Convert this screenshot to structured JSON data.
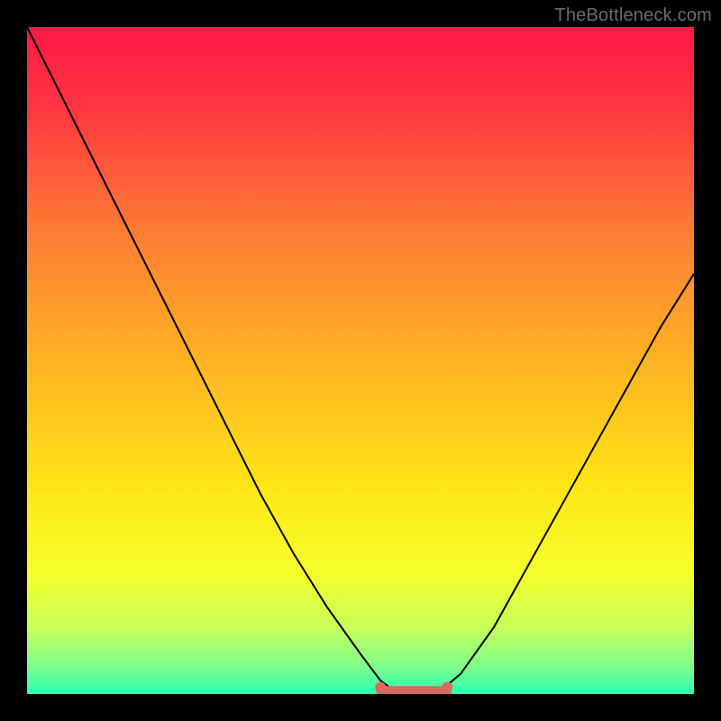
{
  "watermark": "TheBottleneck.com",
  "colors": {
    "frame": "#000000",
    "curve": "#000000",
    "marker": "#d9695f",
    "gradient_stops": [
      {
        "offset": 0.0,
        "color": "#ff1846"
      },
      {
        "offset": 0.12,
        "color": "#ff3642"
      },
      {
        "offset": 0.3,
        "color": "#ff7a34"
      },
      {
        "offset": 0.5,
        "color": "#ffb224"
      },
      {
        "offset": 0.68,
        "color": "#ffe317"
      },
      {
        "offset": 0.82,
        "color": "#f4ff2a"
      },
      {
        "offset": 0.9,
        "color": "#c9ff5a"
      },
      {
        "offset": 0.96,
        "color": "#7dff8c"
      },
      {
        "offset": 1.0,
        "color": "#2cffb4"
      }
    ]
  },
  "chart_data": {
    "type": "line",
    "title": "",
    "xlabel": "",
    "ylabel": "",
    "xlim": [
      0,
      100
    ],
    "ylim": [
      0,
      100
    ],
    "grid": false,
    "x": [
      0,
      5,
      10,
      15,
      20,
      25,
      30,
      35,
      40,
      45,
      50,
      53,
      55,
      58,
      60,
      62,
      65,
      70,
      75,
      80,
      85,
      90,
      95,
      100
    ],
    "series": [
      {
        "name": "bottleneck-curve",
        "values": [
          100,
          90,
          80,
          70,
          60,
          50,
          40,
          30,
          21,
          13,
          6,
          2,
          0.5,
          0,
          0,
          0.5,
          3,
          10,
          19,
          28,
          37,
          46,
          55,
          63
        ]
      }
    ],
    "flat_region": {
      "x_start": 53,
      "x_end": 63,
      "y": 0.5
    },
    "markers": [
      {
        "x": 53,
        "y": 1
      },
      {
        "x": 63,
        "y": 1
      }
    ]
  }
}
